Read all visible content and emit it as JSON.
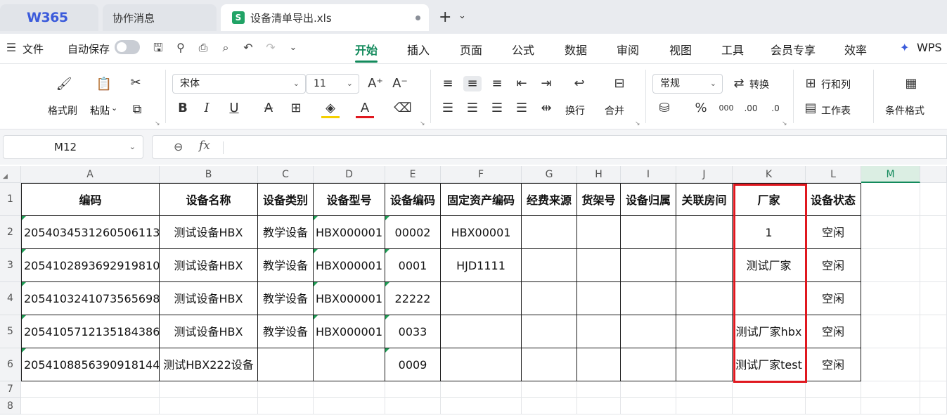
{
  "tabs": {
    "home": "W365",
    "messages": "协作消息",
    "file": "设备清单导出.xls",
    "file_badge": "S"
  },
  "menubar": {
    "menu_label": "文件",
    "autosave_label": "自动保存",
    "ribbon_tabs": [
      "开始",
      "插入",
      "页面",
      "公式",
      "数据",
      "审阅",
      "视图",
      "工具",
      "会员专享",
      "效率"
    ],
    "wps_label": "WPS"
  },
  "ribbon": {
    "format_painter": "格式刷",
    "paste": "粘贴",
    "font_name": "宋体",
    "font_size": "11",
    "wrap": "换行",
    "merge": "合并",
    "number_format": "常规",
    "convert": "转换",
    "rows_cols": "行和列",
    "worksheet": "工作表",
    "conditional": "条件格式"
  },
  "formula_bar": {
    "name_box": "M12",
    "fx": "fx",
    "content": ""
  },
  "sheet": {
    "columns": [
      "A",
      "B",
      "C",
      "D",
      "E",
      "F",
      "G",
      "H",
      "I",
      "J",
      "K",
      "L",
      "M"
    ],
    "rows": [
      "1",
      "2",
      "3",
      "4",
      "5",
      "6",
      "7",
      "8"
    ],
    "selected_column": "M",
    "header": [
      "编码",
      "设备名称",
      "设备类别",
      "设备型号",
      "设备编码",
      "固定资产编码",
      "经费来源",
      "货架号",
      "设备归属",
      "关联房间",
      "厂家",
      "设备状态"
    ],
    "data": [
      [
        "205403453126050​6113",
        "测试设备HBX",
        "教学设备",
        "HBX000001",
        "00002",
        "HBX00001",
        "",
        "",
        "",
        "",
        "1",
        "空闲"
      ],
      [
        "2054102893692919810",
        "测试设备HBX",
        "教学设备",
        "HBX000001",
        "0001",
        "HJD1111",
        "",
        "",
        "",
        "",
        "测试厂家",
        "空闲"
      ],
      [
        "2054103241073565698",
        "测试设备HBX",
        "教学设备",
        "HBX000001",
        "22222",
        "",
        "",
        "",
        "",
        "",
        "",
        "空闲"
      ],
      [
        "2054105712135184386",
        "测试设备HBX",
        "教学设备",
        "HBX000001",
        "0033",
        "",
        "",
        "",
        "",
        "",
        "测试厂家hbx",
        "空闲"
      ],
      [
        "2054108856390918144",
        "测试HBX222设备",
        "",
        "",
        "0009",
        "",
        "",
        "",
        "",
        "",
        "测试厂家test",
        "空闲"
      ]
    ]
  },
  "colors": {
    "accent": "#138a5c",
    "highlight_box": "#e0181f"
  }
}
